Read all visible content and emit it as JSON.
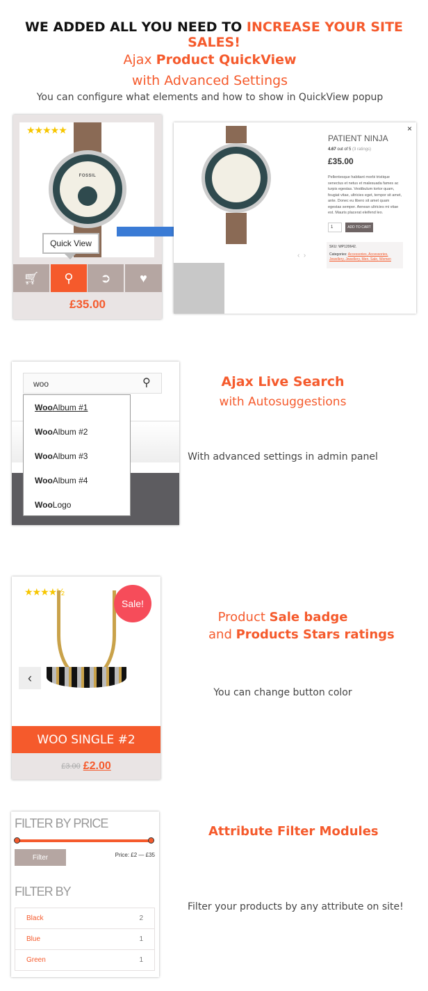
{
  "banner": {
    "title_a": "WE ADDED ALL YOU NEED TO ",
    "title_b": "INCREASE YOUR SITE SALES!"
  },
  "colors": {
    "accent": "#f55a2c",
    "arrow": "#3a7bd5",
    "button": "#b5a6a2",
    "sale": "#f64c5a",
    "stars": "#f7c600"
  },
  "s1": {
    "h1_a": "Ajax ",
    "h1_b": "Product QuickView",
    "h2": "with Advanced Settings",
    "desc": "You can configure what elements and how to show in QuickView popup",
    "card": {
      "rating": 5,
      "tooltip": "Quick View",
      "price": "£35.00",
      "buttons": [
        "cart-icon",
        "search-icon",
        "arrow-circle-icon",
        "heart-icon"
      ],
      "watch_brand": "FOSSIL"
    },
    "popup": {
      "close": "×",
      "title": "PATIENT NINJA",
      "rating_value": "4.67",
      "rating_of": "out of 5",
      "ratings": "(3 ratings)",
      "price": "£35.00",
      "description": "Pellentesque habitant morbi tristique senectus et netus et malesuada fames ac turpis egestas. Vestibulum tortor quam, feugiat vitae, ultricies eget, tempor sit amet, ante. Donec eu libero sit amet quam egestas semper. Aenean ultricies mi vitae est. Mauris placerat eleifend leo.",
      "qty": "1",
      "add_to_cart": "ADD TO CART",
      "sku_label": "SKU:",
      "sku": "WP120642.",
      "categories_label": "Categories:",
      "categories": [
        "Accessories",
        "Accessories",
        "Jewellery",
        "Jewellery",
        "Men",
        "Sale",
        "Women"
      ],
      "prev": "‹",
      "next": "›"
    }
  },
  "s2": {
    "h1": "Ajax Live Search",
    "h2": "with Autosuggestions",
    "desc": "With advanced settings in admin panel",
    "search_value": "woo",
    "suggestions": [
      {
        "b": "Woo",
        "r": " Album #1"
      },
      {
        "b": "Woo",
        "r": " Album #2"
      },
      {
        "b": "Woo",
        "r": " Album #3"
      },
      {
        "b": "Woo",
        "r": " Album #4"
      },
      {
        "b": "Woo",
        "r": " Logo"
      }
    ]
  },
  "s3": {
    "h1_a": "Product ",
    "h1_b": "Sale badge",
    "h2_a": "and ",
    "h2_b": "Products Stars ratings",
    "desc": "You can change button color",
    "card": {
      "rating": 4.5,
      "badge": "Sale!",
      "title": "WOO SINGLE #2",
      "old_price": "£3.00",
      "price": "£2.00",
      "prev": "‹"
    }
  },
  "s4": {
    "h1": "Attribute Filter Modules",
    "desc": "Filter your products by any attribute on site!",
    "panel": {
      "price_title": "FILTER BY PRICE",
      "filter_button": "Filter",
      "price_label": "Price: £2 — £35",
      "range": [
        2,
        35
      ],
      "attr_title": "FILTER BY",
      "attributes": [
        {
          "name": "Black",
          "count": "2"
        },
        {
          "name": "Blue",
          "count": "1"
        },
        {
          "name": "Green",
          "count": "1"
        }
      ]
    }
  }
}
